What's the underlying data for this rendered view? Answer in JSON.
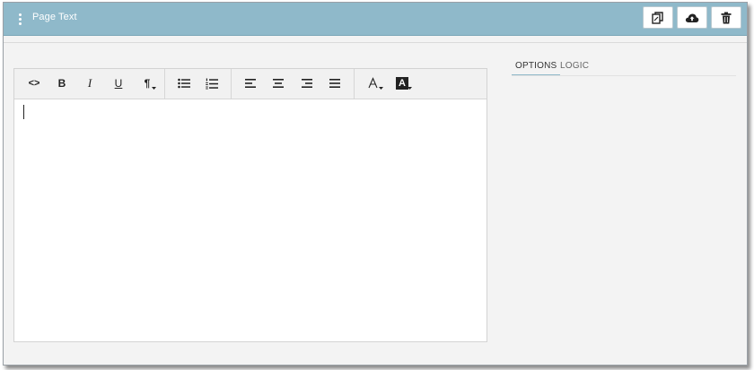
{
  "header": {
    "title": "Page Text",
    "actions": [
      {
        "name": "copy-button",
        "icon": "copy-icon"
      },
      {
        "name": "upload-button",
        "icon": "cloud-upload-icon"
      },
      {
        "name": "delete-button",
        "icon": "trash-icon"
      }
    ]
  },
  "toolbar": {
    "code_label": "<>",
    "bold_label": "B",
    "italic_label": "I",
    "underline_label": "U",
    "paragraph_label": "¶",
    "font_color_label": "A",
    "background_color_label": "A"
  },
  "editor": {
    "content": ""
  },
  "tabs": [
    {
      "label": "OPTIONS",
      "active": true
    },
    {
      "label": "LOGIC",
      "active": false
    }
  ],
  "colors": {
    "header": "#8fb9ca",
    "accent": "#8fb9ca"
  }
}
